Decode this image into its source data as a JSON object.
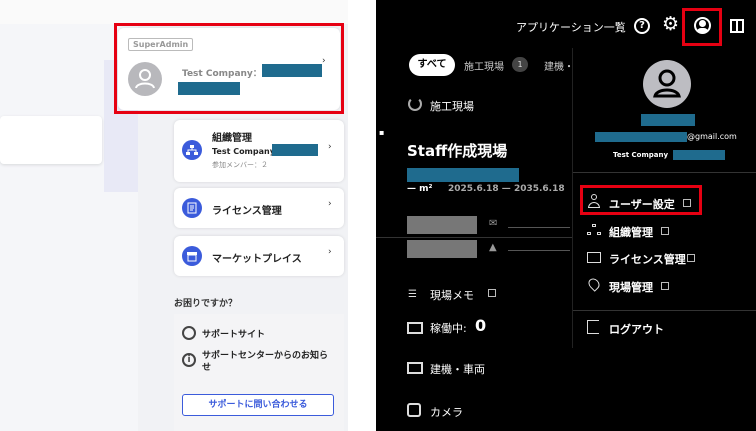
{
  "left": {
    "role_badge": "SuperAdmin",
    "company_label": "Test Company：",
    "org": {
      "title": "組織管理",
      "company": "Test Company：",
      "members": "参加メンバー：２"
    },
    "license": {
      "label": "ライセンス管理"
    },
    "marketplace": {
      "label": "マーケットプレイス"
    },
    "help_heading": "お困りですか？",
    "support_site": "サポートサイト",
    "support_news": "サポートセンターからのお知らせ",
    "contact_button": "サポートに問い合わせる",
    "chevron": "›"
  },
  "right": {
    "header": {
      "app_list": "アプリケーション一覧",
      "help_icon": "?",
      "gear_icon": "⚙"
    },
    "tabs": [
      {
        "label": "すべて"
      },
      {
        "label": "施工現場",
        "count": "1"
      },
      {
        "label": "建機・"
      }
    ],
    "section_title": "施工現場",
    "site_name": "Staff作成現場",
    "site_area": "— m²",
    "site_period": "2025.6.18 — 2035.6.18",
    "memo_label": "現場メモ",
    "active_label": "稼働中:",
    "active_count": "0",
    "vehicles_label": "建機・車両",
    "camera_label": "カメラ",
    "dropdown": {
      "email_suffix": "@gmail.com",
      "company": "Test Company",
      "items": [
        {
          "label": "ユーザー設定"
        },
        {
          "label": "組織管理"
        },
        {
          "label": "ライセンス管理"
        },
        {
          "label": "現場管理"
        }
      ],
      "logout": "ログアウト"
    }
  },
  "colors": {
    "accent_red": "#e60012",
    "redaction": "#1f6b8e",
    "icon_blue": "#3b5bdb"
  }
}
